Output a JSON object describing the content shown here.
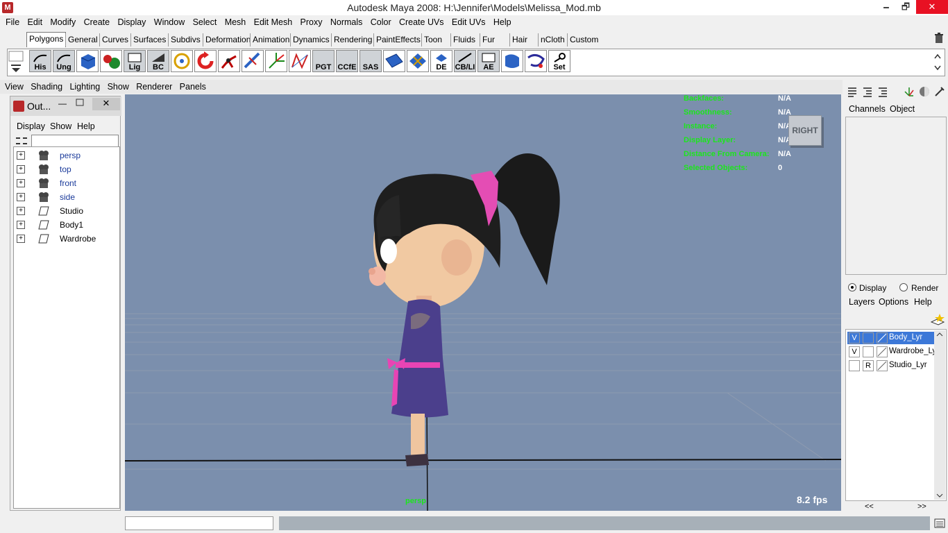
{
  "window": {
    "title": "Autodesk Maya 2008: H:\\Jennifer\\Models\\Melissa_Mod.mb",
    "controls": [
      "🗕",
      "🗗",
      "✕"
    ]
  },
  "menubar": [
    "File",
    "Edit",
    "Modify",
    "Create",
    "Display",
    "Window",
    "Select",
    "Mesh",
    "Edit Mesh",
    "Proxy",
    "Normals",
    "Color",
    "Create UVs",
    "Edit UVs",
    "Help"
  ],
  "shelf_tabs": [
    "Polygons",
    "General",
    "Curves",
    "Surfaces",
    "Subdivs",
    "Deformation",
    "Animation",
    "Dynamics",
    "Rendering",
    "PaintEffects",
    "Toon",
    "Fluids",
    "Fur",
    "Hair",
    "nCloth",
    "Custom"
  ],
  "shelf_active_tab": "Polygons",
  "shelf_tools": [
    "His",
    "Ung",
    "",
    "",
    "Lig",
    "BC",
    "",
    "",
    "",
    "",
    "",
    "",
    "PGT",
    "CCfE",
    "SAS",
    "",
    "",
    "DE",
    "CB/LI",
    "AE",
    "",
    "",
    "Set"
  ],
  "viewport_menu": [
    "View",
    "Shading",
    "Lighting",
    "Show",
    "Renderer",
    "Panels"
  ],
  "outliner": {
    "title": "Out...",
    "menu": [
      "Display",
      "Show",
      "Help"
    ],
    "items": [
      {
        "name": "persp",
        "kind": "camera"
      },
      {
        "name": "top",
        "kind": "camera"
      },
      {
        "name": "front",
        "kind": "camera"
      },
      {
        "name": "side",
        "kind": "camera"
      },
      {
        "name": "Studio",
        "kind": "layer"
      },
      {
        "name": "Body1",
        "kind": "layer"
      },
      {
        "name": "Wardrobe",
        "kind": "layer"
      }
    ]
  },
  "hud": [
    {
      "label": "Backfaces:",
      "value": "N/A"
    },
    {
      "label": "Smoothness:",
      "value": "N/A"
    },
    {
      "label": "Instance:",
      "value": "N/A"
    },
    {
      "label": "Display Layer:",
      "value": "N/A"
    },
    {
      "label": "Distance From Camera:",
      "value": "N/A"
    },
    {
      "label": "Selected Objects:",
      "value": "0"
    }
  ],
  "viewcube_label": "RIGHT",
  "fps": "8.2 fps",
  "camera_label": "persp",
  "channel_box": {
    "tabs": [
      "Channels",
      "Object"
    ]
  },
  "layer_editor": {
    "modes": [
      "Display",
      "Render"
    ],
    "selected_mode": "Display",
    "menu": [
      "Layers",
      "Options",
      "Help"
    ],
    "layers": [
      {
        "visible": "V",
        "type": "",
        "name": "Body_Lyr",
        "selected": true
      },
      {
        "visible": "V",
        "type": "",
        "name": "Wardrobe_Ly",
        "selected": false
      },
      {
        "visible": "",
        "type": "R",
        "name": "Studio_Lyr",
        "selected": false
      }
    ],
    "nav": [
      "<<",
      ">>"
    ]
  },
  "colors": {
    "viewport_bg": "#7b8fad",
    "hud_label": "#1ce61c",
    "selection": "#3c78d8",
    "close_red": "#e81123"
  }
}
